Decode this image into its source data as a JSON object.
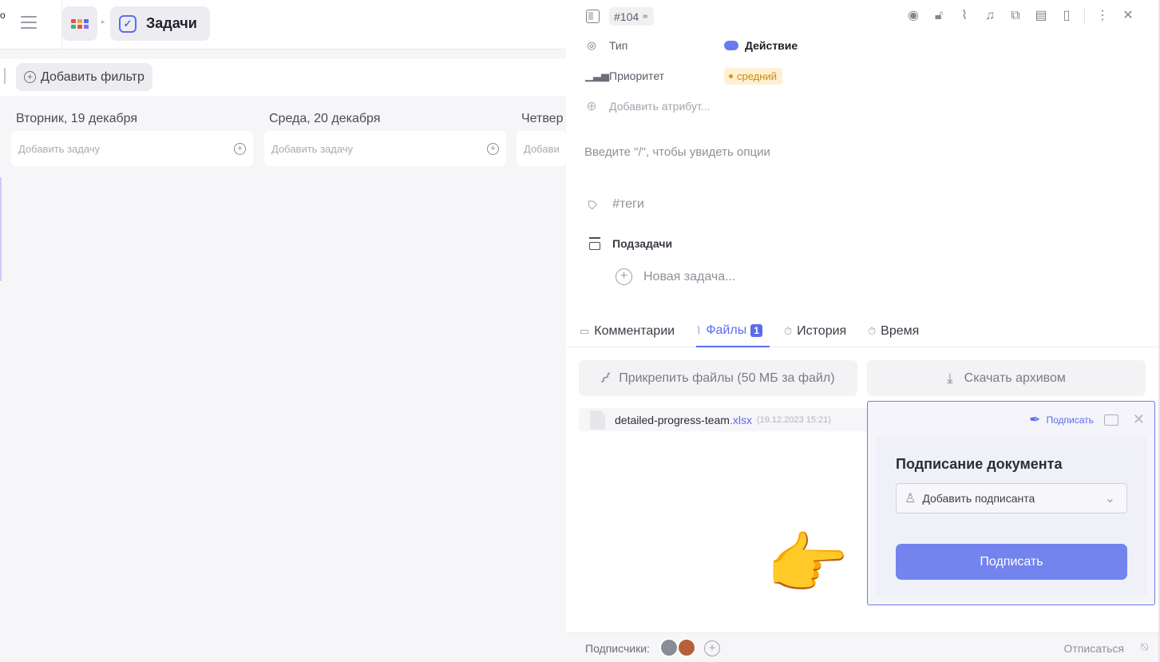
{
  "left": {
    "cut_letter": "о",
    "breadcrumb": {
      "module": "Задачи"
    },
    "filter": {
      "add_label": "Добавить фильтр"
    },
    "columns": [
      {
        "title": "Вторник, 19 декабря",
        "add_placeholder": "Добавить задачу"
      },
      {
        "title": "Среда, 20 декабря",
        "add_placeholder": "Добавить задачу"
      },
      {
        "title": "Четвер",
        "add_placeholder": "Добави"
      }
    ]
  },
  "task": {
    "id": "#104",
    "attributes": {
      "type_label": "Тип",
      "type_value": "Действие",
      "priority_label": "Приоритет",
      "priority_value": "средний",
      "add_attribute": "Добавить атрибут..."
    },
    "editor_placeholder": "Введите \"/\", чтобы увидеть опции",
    "tags_placeholder": "#теги",
    "subtasks": {
      "title": "Подзадачи",
      "new_task": "Новая задача..."
    },
    "tabs": [
      {
        "label": "Комментарии"
      },
      {
        "label": "Файлы",
        "count": "1"
      },
      {
        "label": "История"
      },
      {
        "label": "Время"
      }
    ],
    "files": {
      "attach_label": "Прикрепить файлы (50 МБ за файл)",
      "download_label": "Скачать архивом",
      "items": [
        {
          "name": "detailed-progress-team",
          "ext": ".xlsx",
          "date": "(19.12.2023 15:21)"
        }
      ]
    },
    "sign_popup": {
      "sign_link": "Подписать",
      "title": "Подписание документа",
      "signer_placeholder": "Добавить подписанта",
      "submit_label": "Подписать"
    },
    "footer": {
      "subscribers_label": "Подписчики:",
      "unsubscribe_label": "Отписаться"
    }
  },
  "colors": {
    "accent": "#5b6cf0",
    "submit_button": "#7384ee",
    "priority_badge_bg": "#fdf0d4",
    "priority_badge_text": "#c98a14"
  }
}
